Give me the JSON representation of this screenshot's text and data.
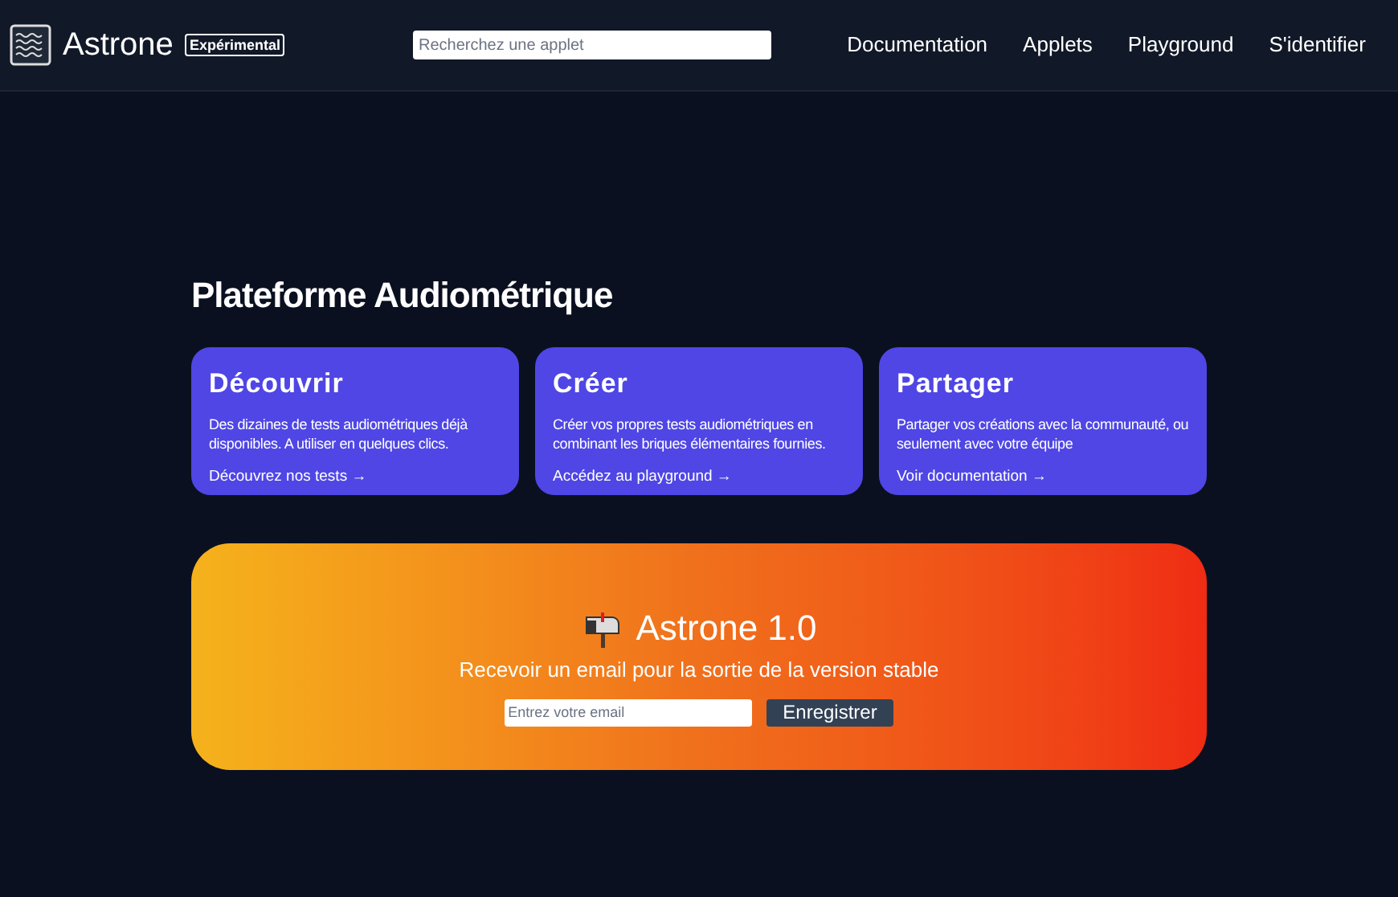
{
  "header": {
    "brand": "Astrone",
    "badge": "Expérimental",
    "search": {
      "placeholder": "Recherchez une applet"
    },
    "nav": [
      "Documentation",
      "Applets",
      "Playground",
      "S'identifier"
    ]
  },
  "title": "Plateforme Audiométrique",
  "cards": [
    {
      "title": "Découvrir",
      "text": "Des dizaines de tests audiométriques déjà disponibles. A utiliser en quelques clics.",
      "link": "Découvrez nos tests →"
    },
    {
      "title": "Créer",
      "text": "Créer vos propres tests audiométriques en combinant les briques élémentaires fournies.",
      "link": "Accédez au playground →"
    },
    {
      "title": "Partager",
      "text": "Partager vos créations avec la communauté, ou seulement avec votre équipe",
      "link": "Voir documentation →"
    }
  ],
  "banner": {
    "title": "Astrone 1.0",
    "subtitle": "Recevoir un email pour la sortie de la version stable",
    "email": {
      "placeholder": "Entrez votre email"
    },
    "button": "Enregistrer"
  }
}
